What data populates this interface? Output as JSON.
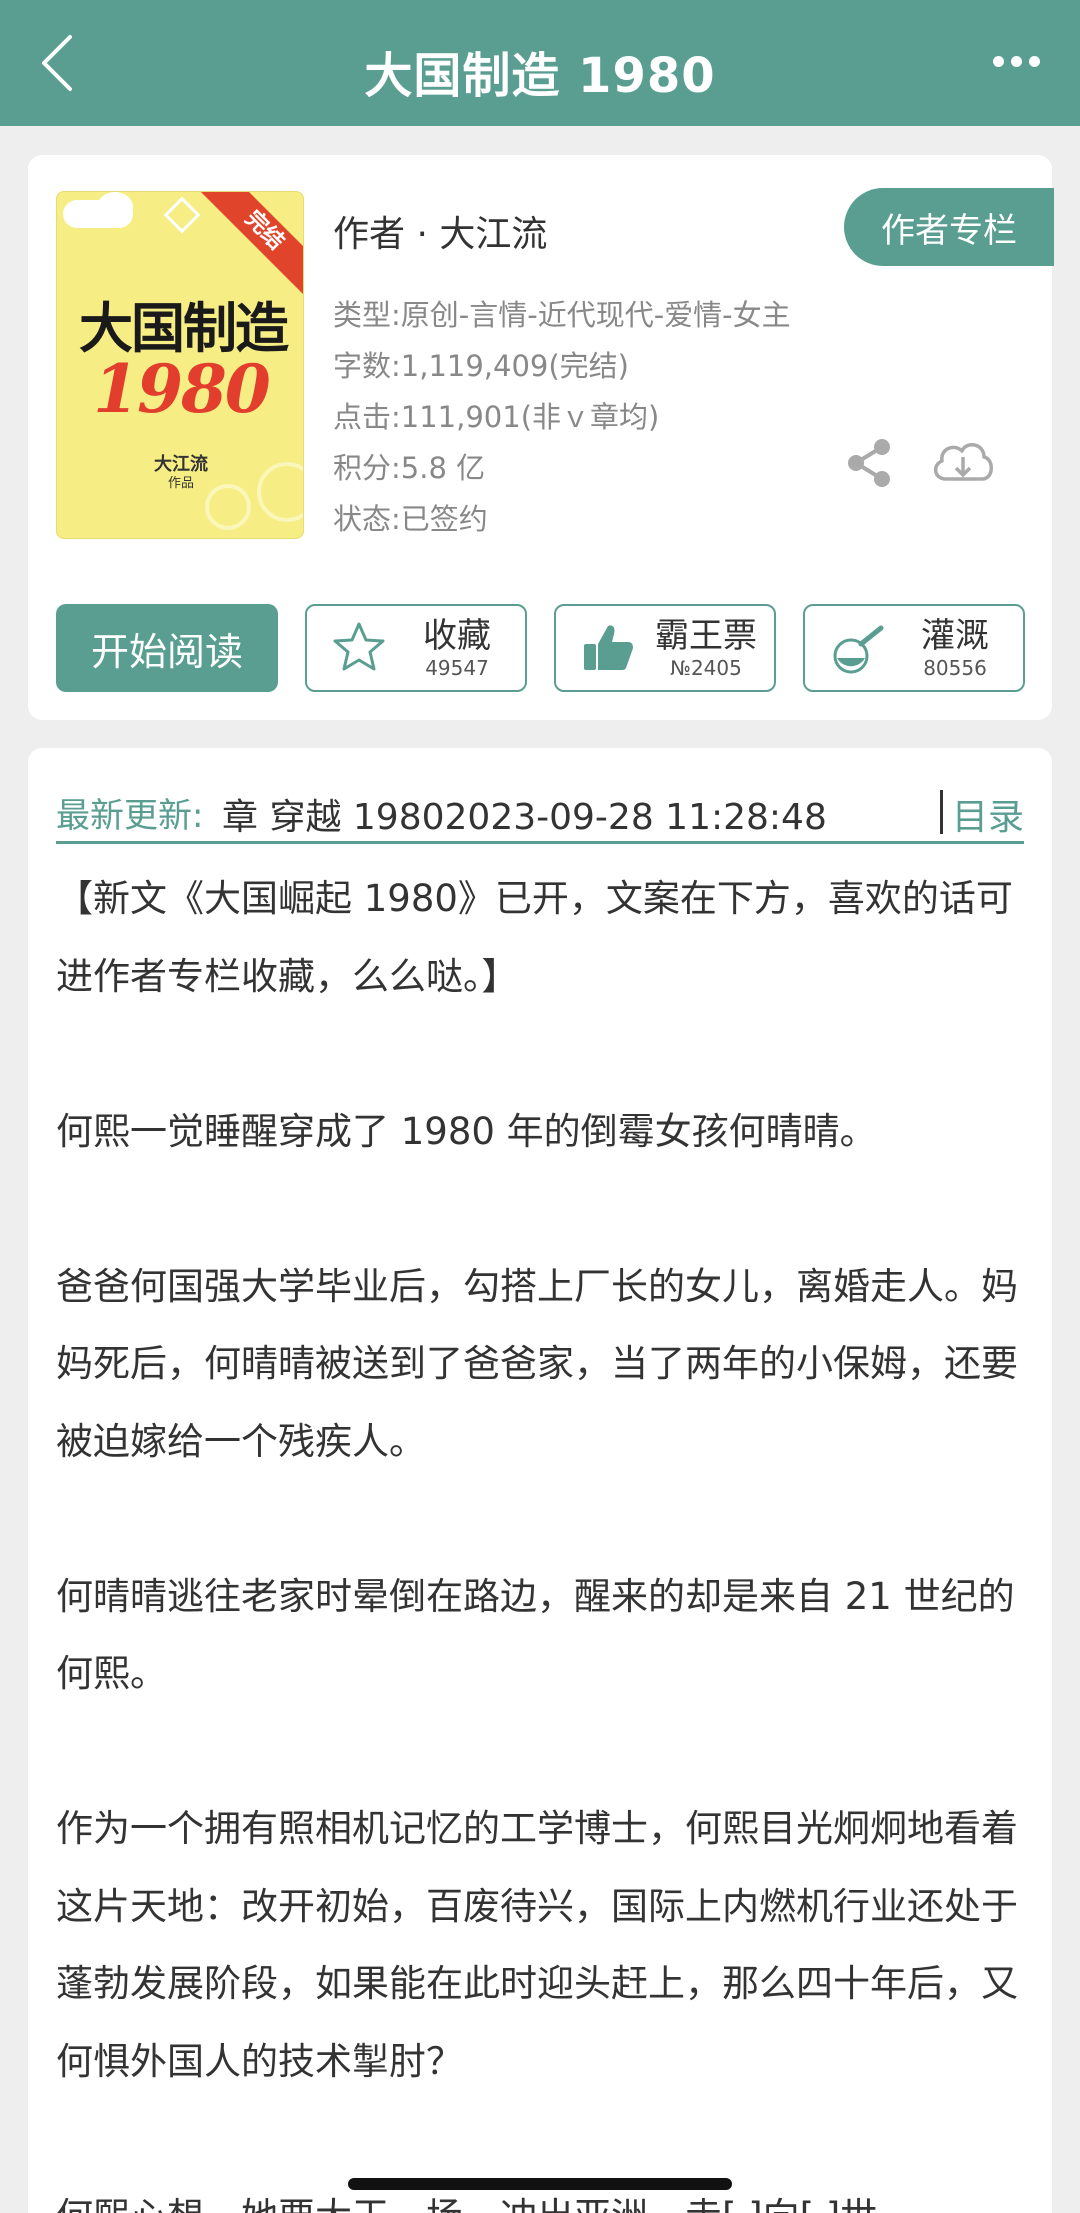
{
  "nav": {
    "title": "大国制造 1980"
  },
  "book": {
    "cover": {
      "title": "大国制造",
      "year": "1980",
      "author": "大江流",
      "sub": "作品",
      "ribbon": "完结"
    },
    "author_line": "作者 · 大江流",
    "column_button": "作者专栏",
    "meta": [
      "类型:原创-言情-近代现代-爱情-女主",
      "字数:1,119,409(完结)",
      "点击:111,901(非ｖ章均)",
      "积分:5.8 亿",
      "状态:已签约"
    ]
  },
  "actions": {
    "read": "开始阅读",
    "favorite": {
      "label": "收藏",
      "count": "49547"
    },
    "ticket": {
      "label": "霸王票",
      "count": "№2405"
    },
    "water": {
      "label": "灌溉",
      "count": "80556"
    }
  },
  "update": {
    "label": "最新更新:",
    "text": "章 穿越 19802023-09-28 11:28:48",
    "toc": "目录"
  },
  "intro": [
    "【新文《大国崛起 1980》已开，文案在下方，喜欢的话可进作者专栏收藏，么么哒。】",
    "",
    "何熙一觉睡醒穿成了 1980 年的倒霉女孩何晴晴。",
    "",
    "爸爸何国强大学毕业后，勾搭上厂长的女儿，离婚走人。妈妈死后，何晴晴被送到了爸爸家，当了两年的小保姆，还要被迫嫁给一个残疾人。",
    "",
    "何晴晴逃往老家时晕倒在路边，醒来的却是来自 21 世纪的何熙。",
    "",
    "作为一个拥有照相机记忆的工学博士，何熙目光炯炯地看着这片天地：改开初始，百废待兴，国际上内燃机行业还处于蓬勃发展阶段，如果能在此时迎头赶上，那么四十年后，又何惧外国人的技术掣肘？",
    "",
    "何熙心想，她要大干一场，冲出亚洲，走[ ]向[ ]世"
  ],
  "colors": {
    "accent": "#5a9e92",
    "background": "#eeeeee"
  }
}
